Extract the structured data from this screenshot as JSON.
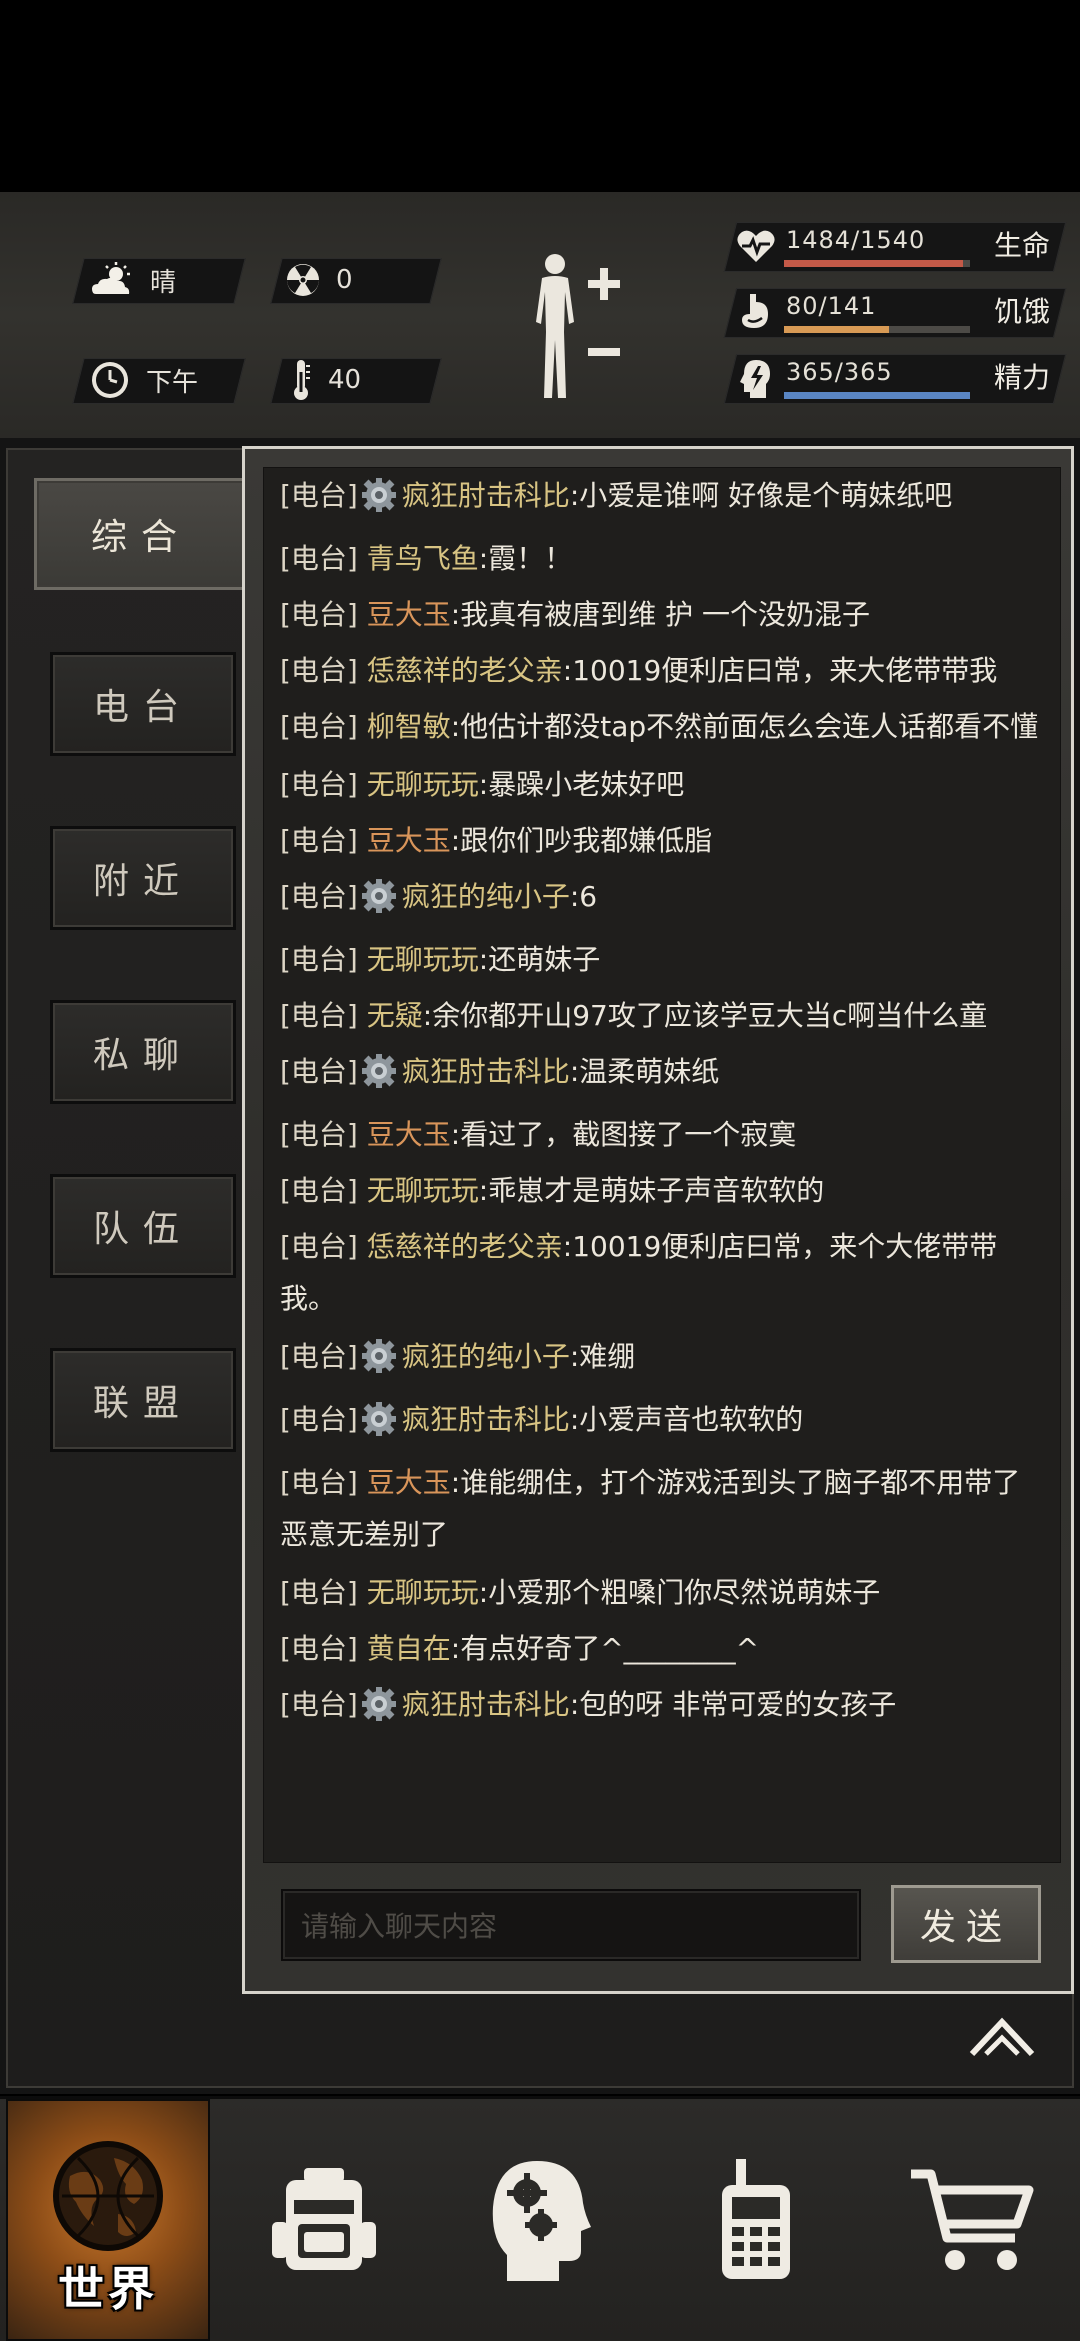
{
  "status": {
    "weather": "晴",
    "radiation": "0",
    "time_of_day": "下午",
    "temperature": "40",
    "health": {
      "text": "1484/1540",
      "label": "生命",
      "fraction": 0.964,
      "color": "#c45a48"
    },
    "hunger": {
      "text": "80/141",
      "label": "饥饿",
      "fraction": 0.567,
      "color": "#d89a55"
    },
    "energy": {
      "text": "365/365",
      "label": "精力",
      "fraction": 1.0,
      "color": "#5a86c4"
    }
  },
  "tabs": [
    {
      "label": "综合",
      "active": true
    },
    {
      "label": "电台",
      "active": false
    },
    {
      "label": "附近",
      "active": false
    },
    {
      "label": "私聊",
      "active": false
    },
    {
      "label": "队伍",
      "active": false
    },
    {
      "label": "联盟",
      "active": false
    }
  ],
  "messages": [
    {
      "tag": "[电台]",
      "badge": true,
      "name": "疯狂肘击科比",
      "name_color": "gold",
      "text": ":小爱是谁啊 好像是个萌妹纸吧"
    },
    {
      "tag": "[电台]",
      "badge": false,
      "name": "青鸟飞鱼",
      "name_color": "gold",
      "text": ":霞！！"
    },
    {
      "tag": "[电台]",
      "badge": false,
      "name": "豆大玉",
      "name_color": "orange",
      "text": ":我真有被唐到维 护 一个没奶混子"
    },
    {
      "tag": "[电台]",
      "badge": false,
      "name": "恁慈祥的老父亲",
      "name_color": "gold",
      "text": ":10019便利店曰常，来大佬带带我"
    },
    {
      "tag": "[电台]",
      "badge": false,
      "name": "柳智敏",
      "name_color": "gold",
      "text": ":他估计都没tap不然前面怎么会连人话都看不懂",
      "wrap": true
    },
    {
      "tag": "[电台]",
      "badge": false,
      "name": "无聊玩玩",
      "name_color": "gold",
      "text": ":暴躁小老妹好吧"
    },
    {
      "tag": "[电台]",
      "badge": false,
      "name": "豆大玉",
      "name_color": "orange",
      "text": ":跟你们吵我都嫌低脂"
    },
    {
      "tag": "[电台]",
      "badge": true,
      "name": "疯狂的纯小子",
      "name_color": "gold",
      "text": ":6"
    },
    {
      "tag": "[电台]",
      "badge": false,
      "name": "无聊玩玩",
      "name_color": "gold",
      "text": ":还萌妹子"
    },
    {
      "tag": "[电台]",
      "badge": false,
      "name": "无疑",
      "name_color": "gold",
      "text": ":余你都开山97攻了应该学豆大当c啊当什么童"
    },
    {
      "tag": "[电台]",
      "badge": true,
      "name": "疯狂肘击科比",
      "name_color": "gold",
      "text": ":温柔萌妹纸"
    },
    {
      "tag": "[电台]",
      "badge": false,
      "name": "豆大玉",
      "name_color": "orange",
      "text": ":看过了，截图接了一个寂寞"
    },
    {
      "tag": "[电台]",
      "badge": false,
      "name": "无聊玩玩",
      "name_color": "gold",
      "text": ":乖崽才是萌妹子声音软软的"
    },
    {
      "tag": "[电台]",
      "badge": false,
      "name": "恁慈祥的老父亲",
      "name_color": "gold",
      "text": ":10019便利店曰常，来个大佬带带我。",
      "wrap": true
    },
    {
      "tag": "[电台]",
      "badge": true,
      "name": "疯狂的纯小子",
      "name_color": "gold",
      "text": ":难绷"
    },
    {
      "tag": "[电台]",
      "badge": true,
      "name": "疯狂肘击科比",
      "name_color": "gold",
      "text": ":小爱声音也软软的"
    },
    {
      "tag": "[电台]",
      "badge": false,
      "name": "豆大玉",
      "name_color": "orange",
      "text": ":谁能绷住，打个游戏活到头了脑子都不用带了恶意无差别了",
      "wrap": true
    },
    {
      "tag": "[电台]",
      "badge": false,
      "name": "无聊玩玩",
      "name_color": "gold",
      "text": ":小爱那个粗嗓门你尽然说萌妹子"
    },
    {
      "tag": "[电台]",
      "badge": false,
      "name": "黄自在",
      "name_color": "gold",
      "text": ":有点好奇了^________^"
    },
    {
      "tag": "[电台]",
      "badge": true,
      "name": "疯狂肘击科比",
      "name_color": "gold",
      "text": ":包的呀 非常可爱的女孩子"
    }
  ],
  "input": {
    "placeholder": "请输入聊天内容"
  },
  "send_label": "发送",
  "bottom_nav": [
    {
      "icon": "globe-icon",
      "label": "世界",
      "active": true
    },
    {
      "icon": "backpack-icon",
      "label": "",
      "active": false
    },
    {
      "icon": "head-gears-icon",
      "label": "",
      "active": false
    },
    {
      "icon": "radio-icon",
      "label": "",
      "active": false
    },
    {
      "icon": "cart-icon",
      "label": "",
      "active": false
    }
  ]
}
